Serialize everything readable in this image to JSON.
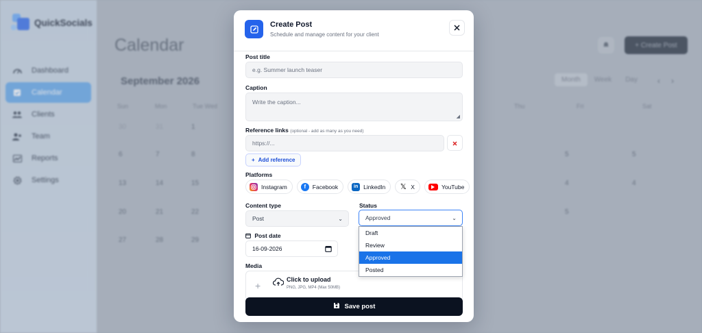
{
  "brand": {
    "name": "QuickSocials"
  },
  "sidebar": {
    "items": [
      {
        "label": "Dashboard",
        "icon": "dashboard-icon"
      },
      {
        "label": "Calendar",
        "icon": "calendar-icon",
        "active": true
      },
      {
        "label": "Clients",
        "icon": "clients-icon"
      },
      {
        "label": "Team",
        "icon": "team-icon"
      },
      {
        "label": "Reports",
        "icon": "reports-icon"
      },
      {
        "label": "Settings",
        "icon": "settings-icon"
      }
    ]
  },
  "background": {
    "page_title": "Calendar",
    "create_button": "+ Create Post",
    "month_label": "September 2026",
    "view_tabs": [
      "Month",
      "Week",
      "Day"
    ],
    "weekdays_left": [
      "Sun",
      "Mon",
      "Tue Wed"
    ],
    "weekdays_right": [
      "Thu",
      "Fri",
      "Sat"
    ],
    "days": [
      "30",
      "31",
      "1",
      "6",
      "7",
      "8",
      "13",
      "14",
      "15",
      "20",
      "21",
      "22",
      "27",
      "28",
      "29",
      "5",
      "5",
      "4",
      "4",
      "5"
    ]
  },
  "modal": {
    "title": "Create Post",
    "subtitle": "Schedule and manage content for your client",
    "post_title": {
      "label": "Post title",
      "placeholder": "e.g. Summer launch teaser"
    },
    "caption": {
      "label": "Caption",
      "placeholder": "Write the caption..."
    },
    "reference_links": {
      "label": "Reference links",
      "hint": "(optional - add as many as you need)",
      "placeholder": "https://..."
    },
    "add_reference": "Add reference",
    "platforms_label": "Platforms",
    "platforms": [
      {
        "name": "Instagram",
        "color": "#e1306c"
      },
      {
        "name": "Facebook",
        "color": "#1877f2"
      },
      {
        "name": "LinkedIn",
        "color": "#0a66c2"
      },
      {
        "name": "X",
        "color": "#000000"
      },
      {
        "name": "YouTube",
        "color": "#ff0000"
      }
    ],
    "content_type": {
      "label": "Content type",
      "value": "Post"
    },
    "status": {
      "label": "Status",
      "value": "Approved",
      "options": [
        "Draft",
        "Review",
        "Approved",
        "Posted"
      ],
      "selected_index": 2
    },
    "post_date": {
      "label": "Post date",
      "value": "16-09-2026"
    },
    "media": {
      "label": "Media",
      "upload_title": "Click to upload",
      "upload_hint": "PNG, JPG, MP4 (Max 50MB)"
    },
    "save_button": "Save post"
  },
  "colors": {
    "accent": "#2563eb",
    "dropdown_selected": "#1a73e8",
    "save_bg": "#0b1220"
  }
}
